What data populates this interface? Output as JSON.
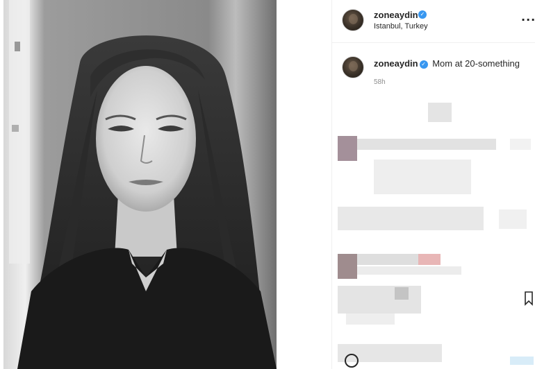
{
  "post": {
    "username": "zoneaydin",
    "verified_glyph": "✓",
    "location": "Istanbul, Turkey",
    "more_glyph": "···",
    "caption": "Mom at 20-something",
    "timestamp": "58h"
  },
  "icons": {
    "more": "more-horizontal-icon",
    "verified": "verified-badge-icon",
    "bookmark": "bookmark-icon",
    "emoji": "emoji-icon"
  },
  "colors": {
    "verified_blue": "#3897f0",
    "text": "#262626",
    "secondary_text": "#8e8e8e",
    "divider": "#efefef"
  }
}
